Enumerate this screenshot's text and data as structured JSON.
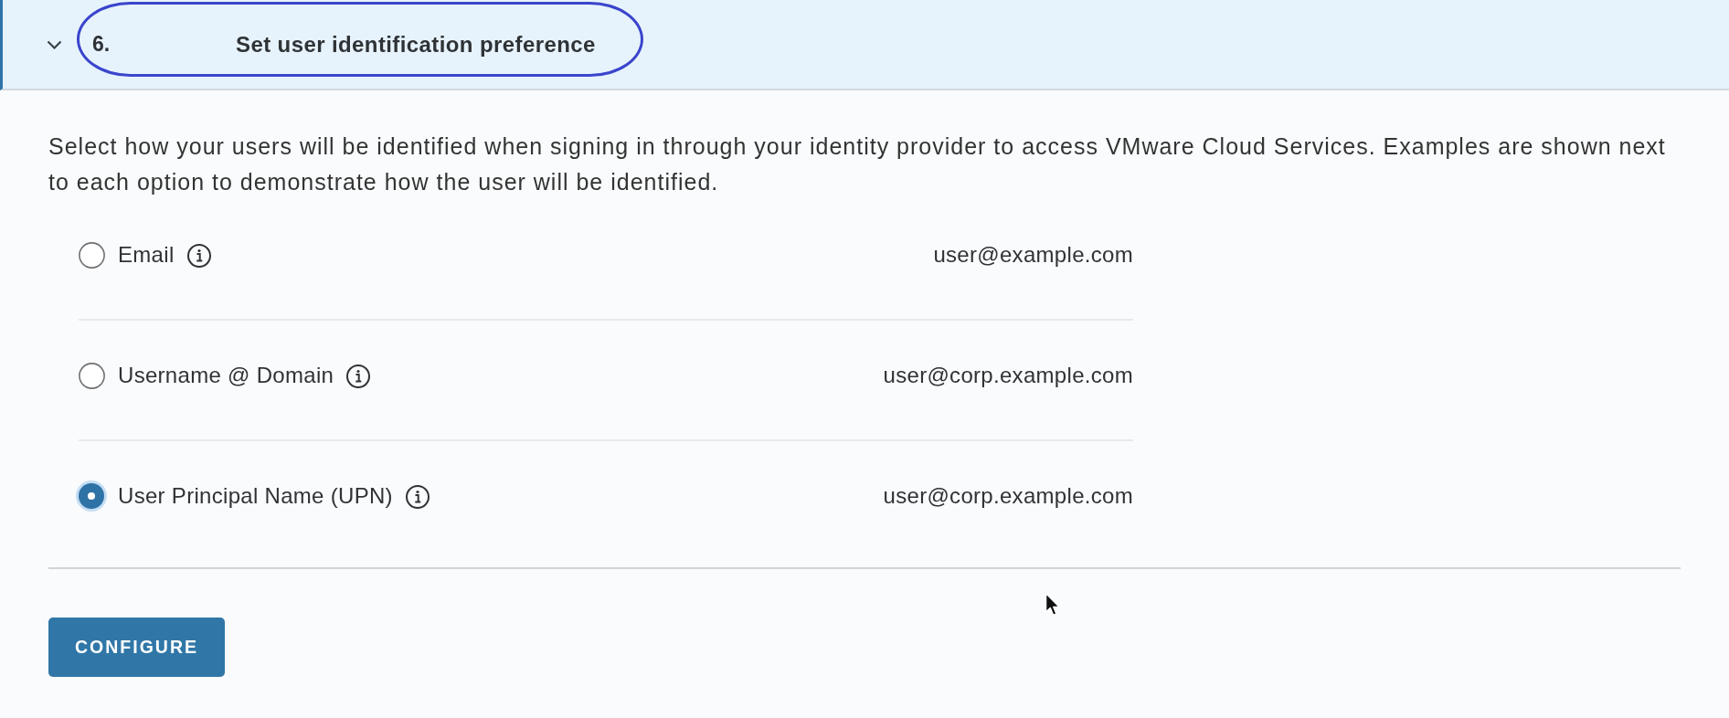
{
  "section": {
    "expanded": true,
    "number": "6.",
    "title": "Set user identification preference",
    "highlighted": true
  },
  "description": "Select how your users will be identified when signing in through your identity provider to access VMware Cloud Services. Examples are shown next to each option to demonstrate how the user will be identified.",
  "options": [
    {
      "label": "Email",
      "example": "user@example.com",
      "selected": false
    },
    {
      "label": "Username @ Domain",
      "example": "user@corp.example.com",
      "selected": false
    },
    {
      "label": "User Principal Name (UPN)",
      "example": "user@corp.example.com",
      "selected": true
    }
  ],
  "buttons": [
    {
      "label": "CONFIGURE"
    }
  ]
}
